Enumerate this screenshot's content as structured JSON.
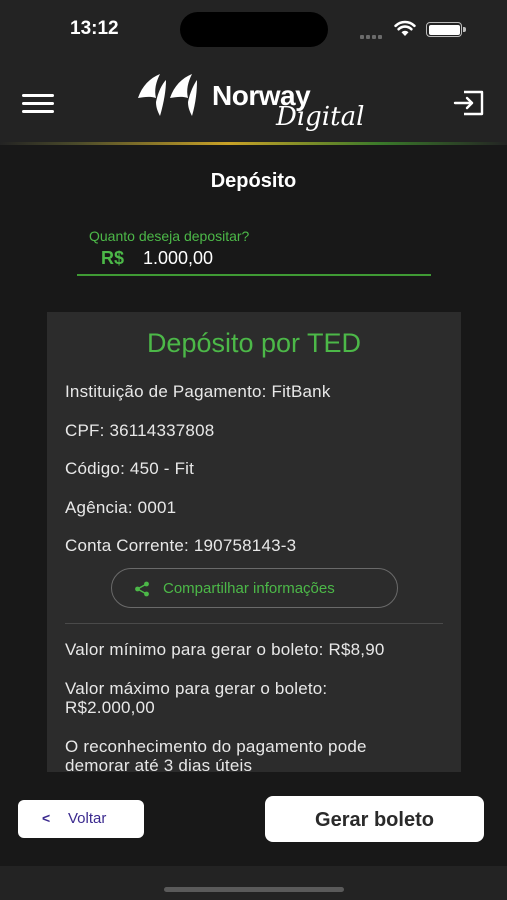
{
  "status_bar": {
    "time": "13:12"
  },
  "header": {
    "brand_name": "Norway",
    "brand_sub": "Digital",
    "menu_icon": "hamburger-menu-icon",
    "logout_icon": "logout-icon"
  },
  "page": {
    "title": "Depósito"
  },
  "amount": {
    "label": "Quanto deseja depositar?",
    "currency": "R$",
    "value": "1.000,00"
  },
  "ted_card": {
    "title": "Depósito por TED",
    "institution": "Instituição de Pagamento: FitBank",
    "cpf": "CPF: 36114337808",
    "code": "Código: 450 - Fit",
    "agency": "Agência: 0001",
    "account": "Conta Corrente: 190758143-3",
    "share_label": "Compartilhar informações",
    "min_value": "Valor mínimo para gerar o boleto: R$8,90",
    "max_value_line1": "Valor máximo para gerar o boleto:",
    "max_value_line2": "R$2.000,00",
    "recognition_line1": "O reconhecimento do pagamento pode",
    "recognition_line2": "demorar até 3 dias úteis"
  },
  "footer": {
    "back_label": "Voltar",
    "generate_label": "Gerar boleto"
  },
  "colors": {
    "accent_green": "#4cb848",
    "background": "#181818",
    "card": "#2c2c2c",
    "back_text": "#3b2a8f"
  }
}
